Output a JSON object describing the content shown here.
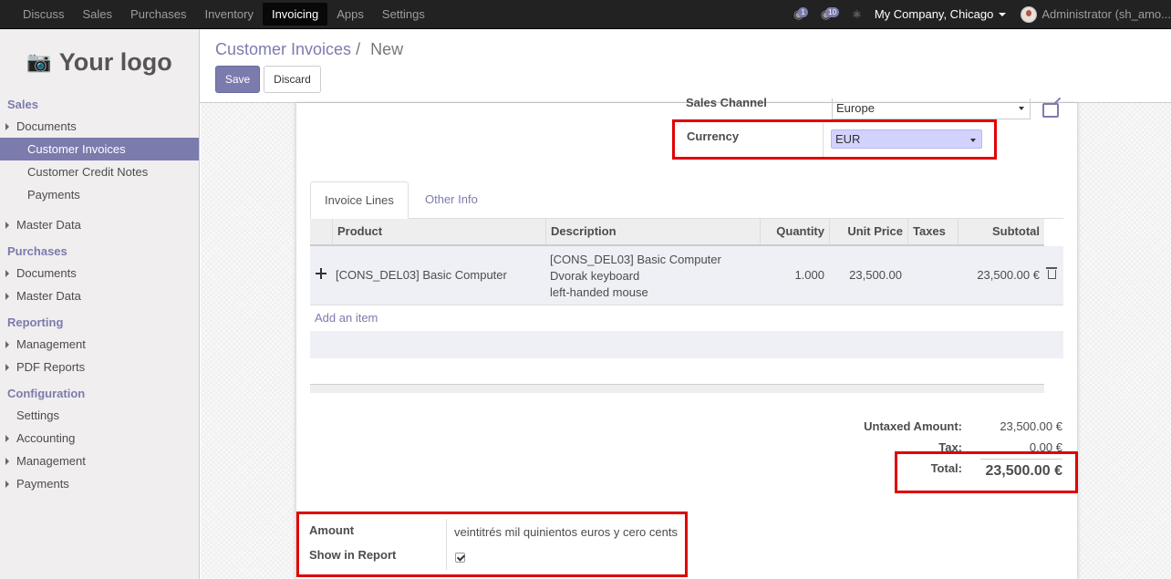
{
  "topnav": {
    "items": [
      "Discuss",
      "Sales",
      "Purchases",
      "Inventory",
      "Invoicing",
      "Apps",
      "Settings"
    ],
    "active": "Invoicing",
    "messages_count": "1",
    "chat_count": "10",
    "company": "My Company, Chicago",
    "user": "Administrator (sh_amo..."
  },
  "sidebar": {
    "logo_text": "Your logo",
    "sections": [
      {
        "title": "Sales",
        "items": [
          {
            "label": "Documents",
            "level": 1
          },
          {
            "label": "Customer Invoices",
            "level": 2,
            "active": true
          },
          {
            "label": "Customer Credit Notes",
            "level": 2
          },
          {
            "label": "Payments",
            "level": 2
          },
          {
            "label": "Master Data",
            "level": 1
          }
        ]
      },
      {
        "title": "Purchases",
        "items": [
          {
            "label": "Documents",
            "level": 1
          },
          {
            "label": "Master Data",
            "level": 1
          }
        ]
      },
      {
        "title": "Reporting",
        "items": [
          {
            "label": "Management",
            "level": 1
          },
          {
            "label": "PDF Reports",
            "level": 1
          }
        ]
      },
      {
        "title": "Configuration",
        "items": [
          {
            "label": "Settings",
            "level": 0
          },
          {
            "label": "Accounting",
            "level": 1
          },
          {
            "label": "Management",
            "level": 1
          },
          {
            "label": "Payments",
            "level": 1
          }
        ]
      }
    ]
  },
  "control": {
    "breadcrumb_parent": "Customer Invoices",
    "breadcrumb_sep": "/",
    "breadcrumb_current": "New",
    "save_label": "Save",
    "discard_label": "Discard"
  },
  "form": {
    "sales_channel_label": "Sales Channel",
    "sales_channel_value": "Europe",
    "currency_label": "Currency",
    "currency_value": "EUR"
  },
  "tabs": [
    "Invoice Lines",
    "Other Info"
  ],
  "table": {
    "headers": [
      "Product",
      "Description",
      "Quantity",
      "Unit Price",
      "Taxes",
      "Subtotal"
    ],
    "rows": [
      {
        "product": "[CONS_DEL03] Basic Computer",
        "description": [
          "[CONS_DEL03] Basic Computer",
          "Dvorak keyboard",
          "left-handed mouse"
        ],
        "quantity": "1.000",
        "unit_price": "23,500.00",
        "taxes": "",
        "subtotal": "23,500.00 €"
      }
    ],
    "add_item": "Add an item"
  },
  "totals": {
    "untaxed_label": "Untaxed Amount:",
    "untaxed_value": "23,500.00 €",
    "tax_label": "Tax:",
    "tax_value": "0.00 €",
    "total_label": "Total:",
    "total_value": "23,500.00 €"
  },
  "amount_words": {
    "amount_label": "Amount",
    "amount_value": "veintitrés mil quinientos euros y cero cents",
    "show_in_report_label": "Show in Report",
    "show_in_report": true
  },
  "colors": {
    "brand": "#7c7bad",
    "highlight": "#e00000",
    "topbar": "#222222"
  }
}
